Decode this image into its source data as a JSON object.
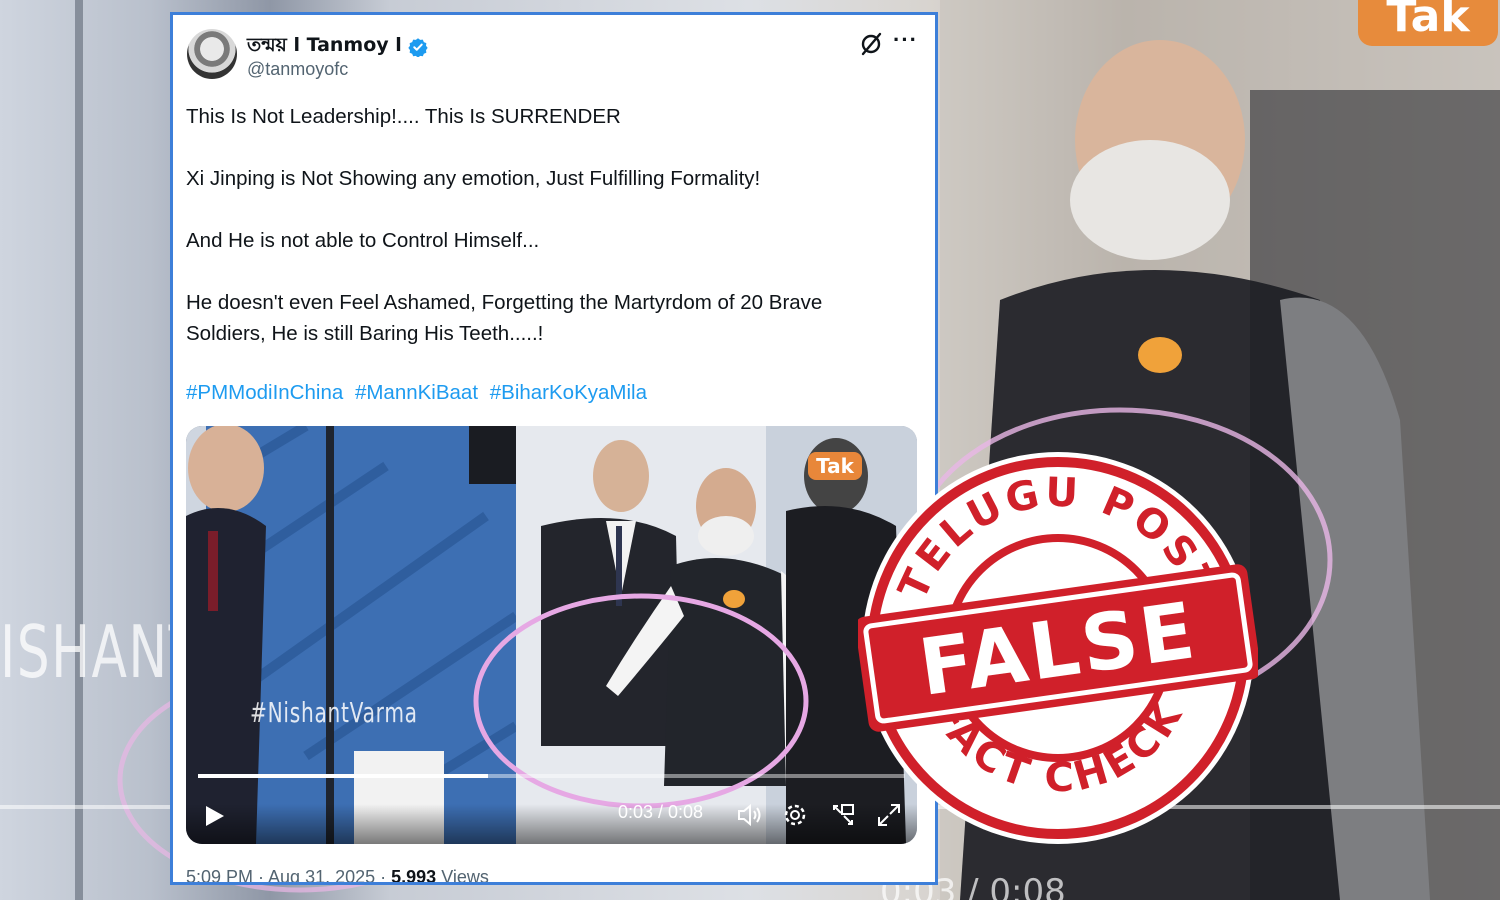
{
  "background": {
    "side_text": "ISHANT",
    "logo_text": "Tak",
    "time_fragment": "0:03 / 0:08"
  },
  "tweet": {
    "display_name": "তন্ময় l Tanmoy l",
    "handle": "@tanmoyofc",
    "paragraphs": [
      "This Is Not Leadership!.... This Is SURRENDER",
      "Xi Jinping is Not Showing any emotion, Just Fulfilling Formality!",
      "And He is not able to Control Himself...",
      "He doesn't even Feel Ashamed, Forgetting the Martyrdom of 20 Brave Soldiers, He is still Baring His Teeth.....!"
    ],
    "hashtags": [
      "#PMModiInChina",
      "#MannKiBaat",
      "#BiharKoKyaMila"
    ],
    "video": {
      "watermark": "#NishantVarma",
      "badge": "Tak",
      "time": "0:03 / 0:08",
      "progress_fraction": 0.41
    },
    "footer": {
      "time": "5:09 PM · Aug 31, 2025 · ",
      "views_count": "5,993",
      "views_label": " Views"
    }
  },
  "stamp": {
    "top_text": "TELUGU POST",
    "middle_text": "FALSE",
    "bottom_text": "FACT CHECK",
    "color": "#d0202a"
  },
  "colors": {
    "accent_link": "#1d9bf0",
    "card_border": "#3d7fd9"
  }
}
